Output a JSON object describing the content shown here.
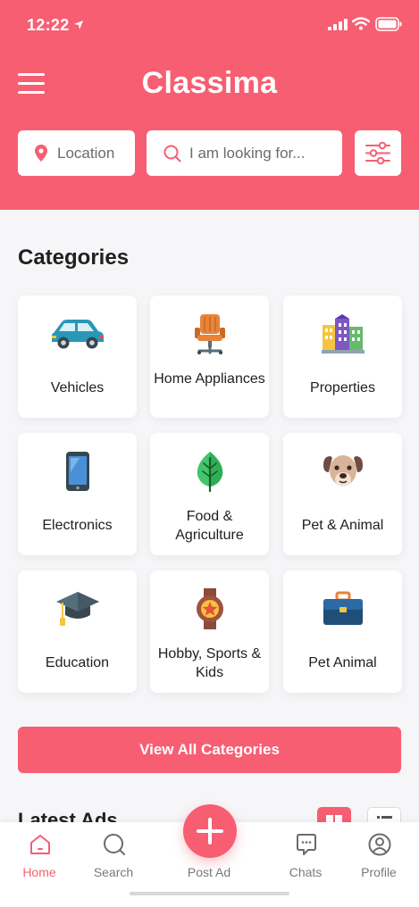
{
  "status_bar": {
    "time": "12:22"
  },
  "header": {
    "brand": "Classima",
    "location_placeholder": "Location",
    "search_placeholder": "I am looking for...",
    "accent_color": "#f75e72"
  },
  "categories": {
    "title": "Categories",
    "items": [
      {
        "label": "Vehicles",
        "icon": "car-icon"
      },
      {
        "label": "Home Appliances",
        "icon": "chair-icon"
      },
      {
        "label": "Properties",
        "icon": "buildings-icon"
      },
      {
        "label": "Electronics",
        "icon": "smartphone-icon"
      },
      {
        "label": "Food & Agriculture",
        "icon": "leaf-icon"
      },
      {
        "label": "Pet & Animal",
        "icon": "dog-icon"
      },
      {
        "label": "Education",
        "icon": "graduation-cap-icon"
      },
      {
        "label": "Hobby, Sports & Kids",
        "icon": "medal-icon"
      },
      {
        "label": "Pet Animal",
        "icon": "briefcase-icon"
      }
    ],
    "view_all_label": "View All Categories"
  },
  "latest_ads": {
    "title": "Latest Ads"
  },
  "tabbar": {
    "home": "Home",
    "search": "Search",
    "post": "Post Ad",
    "chats": "Chats",
    "profile": "Profile",
    "active": "Home"
  }
}
